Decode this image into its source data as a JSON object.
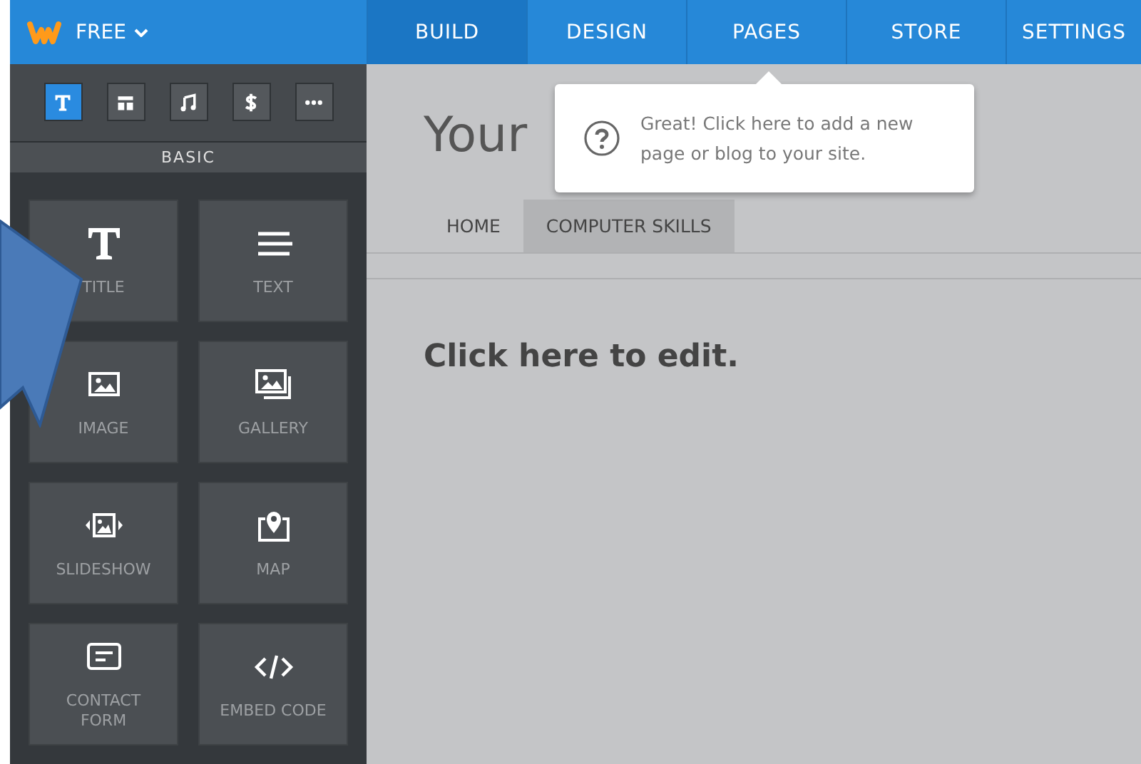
{
  "plan": {
    "label": "FREE"
  },
  "nav_tabs": [
    {
      "label": "BUILD",
      "selected": true
    },
    {
      "label": "DESIGN",
      "selected": false
    },
    {
      "label": "PAGES",
      "selected": false
    },
    {
      "label": "STORE",
      "selected": false
    },
    {
      "label": "SETTINGS",
      "selected": false
    }
  ],
  "sidebar": {
    "categories": [
      {
        "kind": "text",
        "selected": true
      },
      {
        "kind": "layout",
        "selected": false
      },
      {
        "kind": "media",
        "selected": false
      },
      {
        "kind": "commerce",
        "selected": false
      },
      {
        "kind": "more",
        "selected": false
      }
    ],
    "section": "BASIC",
    "elements": [
      {
        "kind": "title",
        "label": "TITLE"
      },
      {
        "kind": "text",
        "label": "TEXT"
      },
      {
        "kind": "image",
        "label": "IMAGE"
      },
      {
        "kind": "gallery",
        "label": "GALLERY"
      },
      {
        "kind": "slideshow",
        "label": "SLIDESHOW"
      },
      {
        "kind": "map",
        "label": "MAP"
      },
      {
        "kind": "form",
        "label": "CONTACT FORM"
      },
      {
        "kind": "embed",
        "label": "EMBED CODE"
      }
    ]
  },
  "site": {
    "title": "Your",
    "pages": [
      {
        "label": "HOME",
        "selected": false
      },
      {
        "label": "COMPUTER SKILLS",
        "selected": true
      }
    ],
    "placeholder_text": "Click here to edit."
  },
  "tooltip": {
    "text": "Great! Click here to add a new page or blog to your site."
  }
}
